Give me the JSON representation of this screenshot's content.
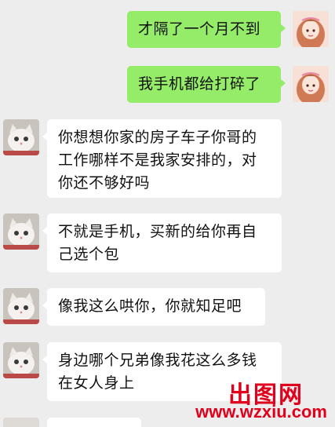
{
  "messages": [
    {
      "sender": "me",
      "text": "才隔了一个月不到"
    },
    {
      "sender": "me",
      "text": "我手机都给打碎了"
    },
    {
      "sender": "other",
      "text": "你想想你家的房子车子你哥的工作哪样不是我家安排的，对你还不够好吗"
    },
    {
      "sender": "other",
      "text": "不就是手机，买新的给你再自己选个包"
    },
    {
      "sender": "other",
      "text": "像我这么哄你，你就知足吧"
    },
    {
      "sender": "other",
      "text": "身边哪个兄弟像我花这么多钱在女人身上"
    }
  ],
  "watermark": {
    "logo": "出图网",
    "url": "www.wzxiu.com"
  },
  "colors": {
    "background": "#ededed",
    "bubble_me": "#95ec69",
    "bubble_other": "#ffffff",
    "watermark": "#e0001b"
  }
}
